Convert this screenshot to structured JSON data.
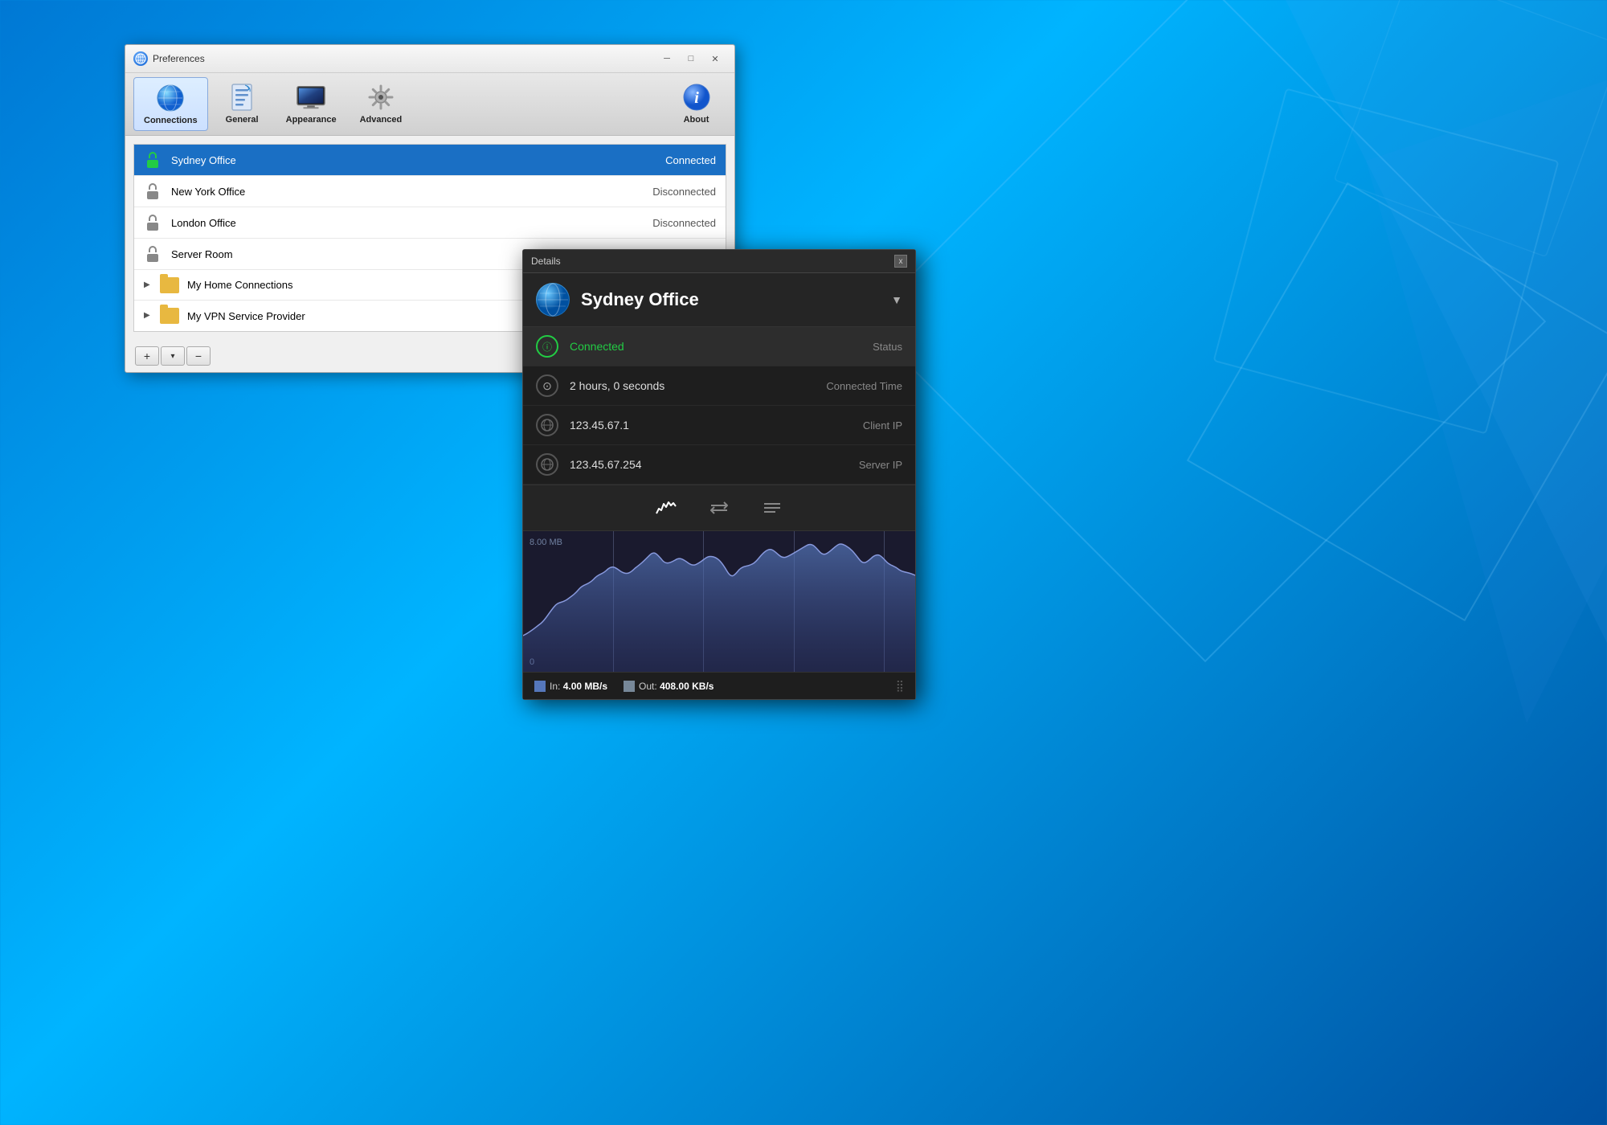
{
  "desktop": {
    "bg_color_start": "#0078d4",
    "bg_color_end": "#0050a0"
  },
  "preferences_window": {
    "title": "Preferences",
    "titlebar_icon": "🌐",
    "controls": {
      "minimize": "─",
      "maximize": "□",
      "close": "✕"
    },
    "toolbar": {
      "items": [
        {
          "id": "connections",
          "label": "Connections",
          "active": true
        },
        {
          "id": "general",
          "label": "General",
          "active": false
        },
        {
          "id": "appearance",
          "label": "Appearance",
          "active": false
        },
        {
          "id": "advanced",
          "label": "Advanced",
          "active": false
        },
        {
          "id": "about",
          "label": "About",
          "active": false
        }
      ]
    },
    "connections": [
      {
        "name": "Sydney Office",
        "status": "Connected",
        "selected": true,
        "type": "vpn"
      },
      {
        "name": "New York Office",
        "status": "Disconnected",
        "selected": false,
        "type": "vpn"
      },
      {
        "name": "London Office",
        "status": "Disconnected",
        "selected": false,
        "type": "vpn"
      },
      {
        "name": "Server Room",
        "status": "",
        "selected": false,
        "type": "vpn"
      },
      {
        "name": "My Home Connections",
        "status": "",
        "selected": false,
        "type": "group"
      },
      {
        "name": "My VPN Service Provider",
        "status": "",
        "selected": false,
        "type": "group"
      }
    ],
    "bottom_buttons": {
      "add": "+",
      "menu": "▾",
      "remove": "−"
    }
  },
  "details_panel": {
    "title": "Details",
    "close_btn": "x",
    "connection_name": "Sydney Office",
    "dropdown_arrow": "▼",
    "info_rows": [
      {
        "icon": "ⓘ",
        "value": "Connected",
        "label": "Status",
        "highlight": true,
        "green": true
      },
      {
        "icon": "🕐",
        "value": "2 hours, 0 seconds",
        "label": "Connected Time",
        "highlight": false
      },
      {
        "icon": "🌐",
        "value": "123.45.67.1",
        "label": "Client IP",
        "highlight": false
      },
      {
        "icon": "🌐",
        "value": "123.45.67.254",
        "label": "Server IP",
        "highlight": false
      }
    ],
    "tabs": [
      "~",
      "⇄",
      "≡"
    ],
    "chart": {
      "label_top": "8.00 MB",
      "label_bottom": "0"
    },
    "stats": {
      "in_label": "In:",
      "in_value": "4.00 MB/s",
      "out_label": "Out:",
      "out_value": "408.00 KB/s"
    }
  }
}
